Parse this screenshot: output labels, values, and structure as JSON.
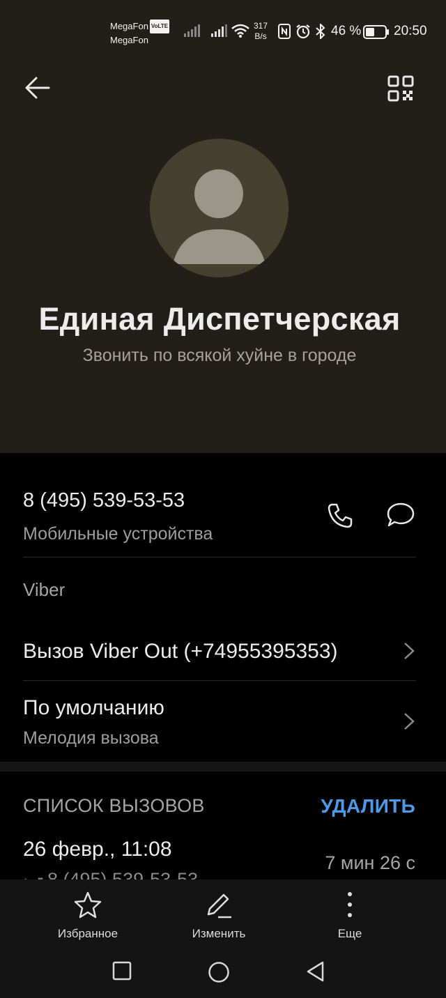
{
  "status_bar": {
    "carrier_1": "MegaFon",
    "volte_badge": "VoLTE",
    "carrier_2": "MegaFon",
    "speed_value": "317",
    "speed_unit": "B/s",
    "battery_percent": "46 %",
    "battery_level": 0.46,
    "time": "20:50"
  },
  "contact": {
    "name": "Единая Диспетчерская",
    "note": "Звонить по всякой хуйне в городе"
  },
  "phone": {
    "number": "8 (495) 539-53-53",
    "type": "Мобильные устройства"
  },
  "viber": {
    "header": "Viber",
    "call_label": "Вызов Viber Out (+74955395353)"
  },
  "ringtone": {
    "value": "По умолчанию",
    "label": "Мелодия вызова"
  },
  "call_log": {
    "title": "СПИСОК ВЫЗОВОВ",
    "delete_label": "УДАЛИТЬ",
    "entries": [
      {
        "date": "26 февр., 11:08",
        "duration": "7 мин 26 с",
        "number": "8 (495) 539-53-53"
      }
    ]
  },
  "bottom_actions": {
    "favorites": "Избранное",
    "edit": "Изменить",
    "more": "Еще"
  },
  "colors": {
    "header_bg": "#221f1a",
    "avatar_bg": "#46412f",
    "accent": "#4d9be6"
  }
}
